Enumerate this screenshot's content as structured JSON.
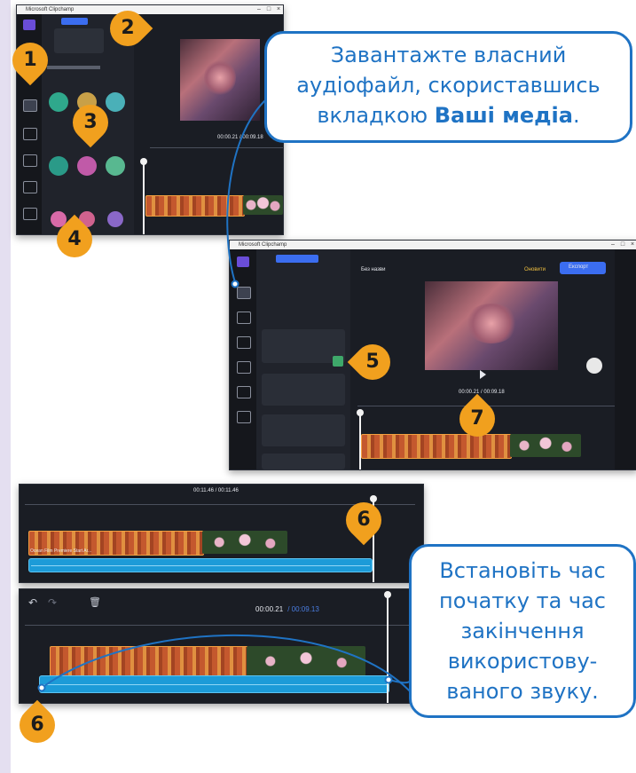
{
  "callouts": {
    "top_text_1": "Завантажте власний",
    "top_text_2": "аудіофайл, скориставшись",
    "top_text_3_prefix": "вкладкою",
    "top_text_3_bold": "Ваші медіа",
    "top_text_3_suffix": ".",
    "right_lines": [
      "Встановіть час",
      "початку та час",
      "закінчення",
      "використову-",
      "ваного звуку."
    ]
  },
  "markers": [
    "1",
    "2",
    "3",
    "4",
    "5",
    "6",
    "7",
    "6",
    "6"
  ],
  "screenshot1": {
    "window_title": "Microsoft Clipchamp",
    "time": "00:00.21 / 00:09.18"
  },
  "screenshot2": {
    "window_title": "Microsoft Clipchamp",
    "tab_label": "Без назви",
    "export_label": "Експорт",
    "upgrade_label": "Оновити",
    "time": "00:00.21 / 00:09.18"
  },
  "screenshot3": {
    "time": "00:11.46 / 00:11.46",
    "audio_label": "Ocean Film Premiere Start Ar..."
  },
  "screenshot4": {
    "time_current": "00:00.21",
    "time_total": "/ 00:09.13"
  },
  "colors": {
    "callout_border": "#1f73c4",
    "marker": "#f1a01e",
    "ui_dark": "#1a1d24",
    "audio_track": "#1c9bd8",
    "accent_blue": "#3b6df0"
  }
}
